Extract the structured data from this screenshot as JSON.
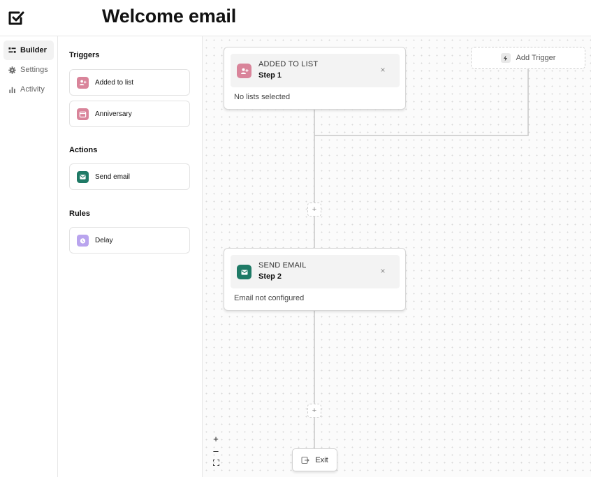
{
  "header": {
    "title": "Welcome email",
    "logo_icon": "check-badge-icon"
  },
  "nav": {
    "items": [
      {
        "label": "Builder",
        "icon": "builder-icon",
        "active": true
      },
      {
        "label": "Settings",
        "icon": "gear-icon",
        "active": false
      },
      {
        "label": "Activity",
        "icon": "bar-chart-icon",
        "active": false
      }
    ]
  },
  "palette": {
    "triggers_title": "Triggers",
    "triggers": [
      {
        "label": "Added to list",
        "icon": "user-plus-icon",
        "color": "#d9849a"
      },
      {
        "label": "Anniversary",
        "icon": "calendar-icon",
        "color": "#d9849a"
      }
    ],
    "actions_title": "Actions",
    "actions": [
      {
        "label": "Send email",
        "icon": "mail-icon",
        "color": "#1f7a66"
      }
    ],
    "rules_title": "Rules",
    "rules": [
      {
        "label": "Delay",
        "icon": "clock-icon",
        "color": "#b9a4ee"
      }
    ]
  },
  "canvas": {
    "add_trigger_label": "Add Trigger",
    "nodes": [
      {
        "kind": "ADDED TO LIST",
        "step": "Step 1",
        "description": "No lists selected",
        "icon": "user-plus-icon",
        "color": "#d9849a"
      },
      {
        "kind": "SEND EMAIL",
        "step": "Step 2",
        "description": "Email not configured",
        "icon": "mail-icon",
        "color": "#1f7a66"
      }
    ],
    "add_step_symbol": "+",
    "close_symbol": "×",
    "exit_label": "Exit",
    "zoom_in_symbol": "+",
    "zoom_out_symbol": "–"
  }
}
